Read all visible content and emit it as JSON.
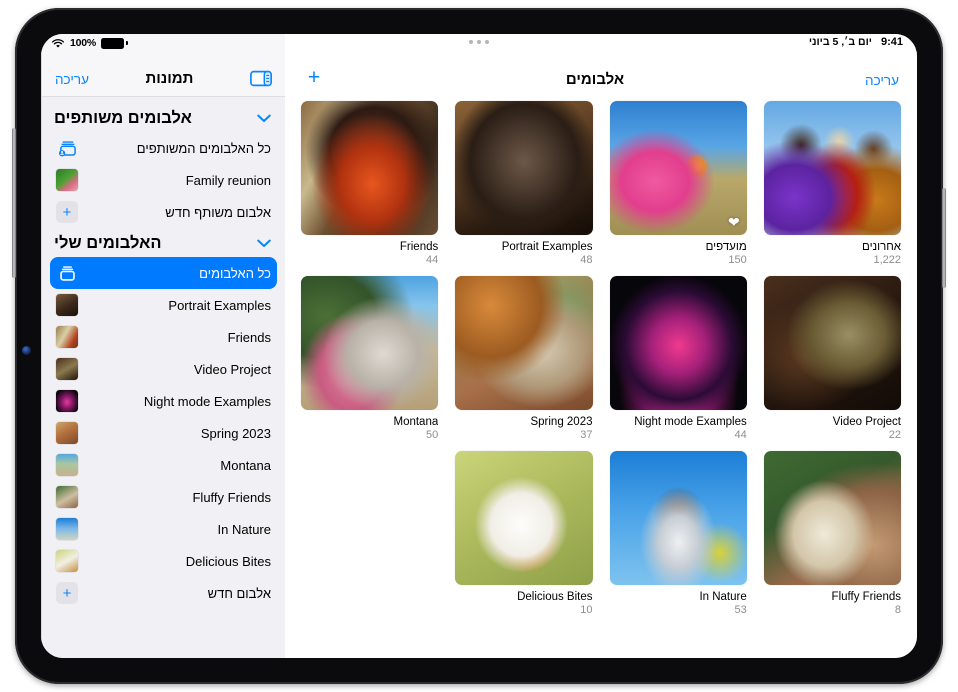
{
  "status_bar": {
    "battery_percent": "100%",
    "battery_icon": "battery-full-icon",
    "wifi_icon": "wifi-icon",
    "time": "9:41",
    "date": "יום ב׳, 5 ביוני"
  },
  "sidebar": {
    "title": "תמונות",
    "edit_label": "עריכה",
    "toggle_icon": "sidebar-toggle-icon",
    "sections": [
      {
        "title": "אלבומים משותפים",
        "chevron_icon": "chevron-down-icon",
        "items": [
          {
            "label": "כל האלבומים המשותפים",
            "icon": "shared-albums-icon",
            "kind": "glyph",
            "selected": false
          },
          {
            "label": "Family reunion",
            "icon": "album-thumbnail",
            "kind": "thumb",
            "art": "th-family",
            "selected": false
          },
          {
            "label": "אלבום משותף חדש",
            "icon": "plus-icon",
            "kind": "plus",
            "selected": false
          }
        ]
      },
      {
        "title": "האלבומים שלי",
        "chevron_icon": "chevron-down-icon",
        "items": [
          {
            "label": "כל האלבומים",
            "icon": "albums-stack-icon",
            "kind": "glyph",
            "selected": true
          },
          {
            "label": "Portrait Examples",
            "icon": "album-thumbnail",
            "kind": "thumb",
            "art": "th-portrait",
            "selected": false
          },
          {
            "label": "Friends",
            "icon": "album-thumbnail",
            "kind": "thumb",
            "art": "th-friends",
            "selected": false
          },
          {
            "label": "Video Project",
            "icon": "album-thumbnail",
            "kind": "thumb",
            "art": "th-video",
            "selected": false
          },
          {
            "label": "Night mode Examples",
            "icon": "album-thumbnail",
            "kind": "thumb",
            "art": "th-night",
            "selected": false
          },
          {
            "label": "Spring 2023",
            "icon": "album-thumbnail",
            "kind": "thumb",
            "art": "th-spring",
            "selected": false
          },
          {
            "label": "Montana",
            "icon": "album-thumbnail",
            "kind": "thumb",
            "art": "th-montana",
            "selected": false
          },
          {
            "label": "Fluffy Friends",
            "icon": "album-thumbnail",
            "kind": "thumb",
            "art": "th-fluffy",
            "selected": false
          },
          {
            "label": "In Nature",
            "icon": "album-thumbnail",
            "kind": "thumb",
            "art": "th-nature",
            "selected": false
          },
          {
            "label": "Delicious Bites",
            "icon": "album-thumbnail",
            "kind": "thumb",
            "art": "th-delicious",
            "selected": false
          },
          {
            "label": "אלבום חדש",
            "icon": "plus-icon",
            "kind": "plus",
            "selected": false
          }
        ]
      }
    ]
  },
  "main": {
    "title": "אלבומים",
    "edit_label": "עריכה",
    "add_icon": "plus-icon",
    "albums": [
      {
        "name": "Friends",
        "count": "44",
        "rtl": false,
        "art": "art-friends",
        "favorite": false,
        "offset": false
      },
      {
        "name": "Portrait Examples",
        "count": "48",
        "rtl": false,
        "art": "art-portrait",
        "favorite": false,
        "offset": false
      },
      {
        "name": "מועדפים",
        "count": "150",
        "rtl": true,
        "art": "art-favorites",
        "favorite": true,
        "offset": false
      },
      {
        "name": "אחרונים",
        "count": "1,222",
        "rtl": true,
        "art": "art-recents",
        "favorite": false,
        "offset": false
      },
      {
        "name": "Montana",
        "count": "50",
        "rtl": false,
        "art": "art-montana",
        "favorite": false,
        "offset": false
      },
      {
        "name": "Spring 2023",
        "count": "37",
        "rtl": false,
        "art": "art-spring",
        "favorite": false,
        "offset": false
      },
      {
        "name": "Night mode Examples",
        "count": "44",
        "rtl": false,
        "art": "art-night",
        "favorite": false,
        "offset": false
      },
      {
        "name": "Video Project",
        "count": "22",
        "rtl": false,
        "art": "art-video",
        "favorite": false,
        "offset": false
      },
      {
        "name": "Delicious Bites",
        "count": "10",
        "rtl": false,
        "art": "art-delicious",
        "favorite": false,
        "offset": true
      },
      {
        "name": "In Nature",
        "count": "53",
        "rtl": false,
        "art": "art-nature",
        "favorite": false,
        "offset": false
      },
      {
        "name": "Fluffy Friends",
        "count": "8",
        "rtl": false,
        "art": "art-fluffy",
        "favorite": false,
        "offset": false
      }
    ],
    "favorite_badge_icon": "heart-icon"
  },
  "colors": {
    "accent": "#0a84ff",
    "selection": "#007aff",
    "sidebar_bg": "#f1f1f5",
    "secondary_text": "#8e8e93"
  },
  "home_indicator": "home-indicator"
}
